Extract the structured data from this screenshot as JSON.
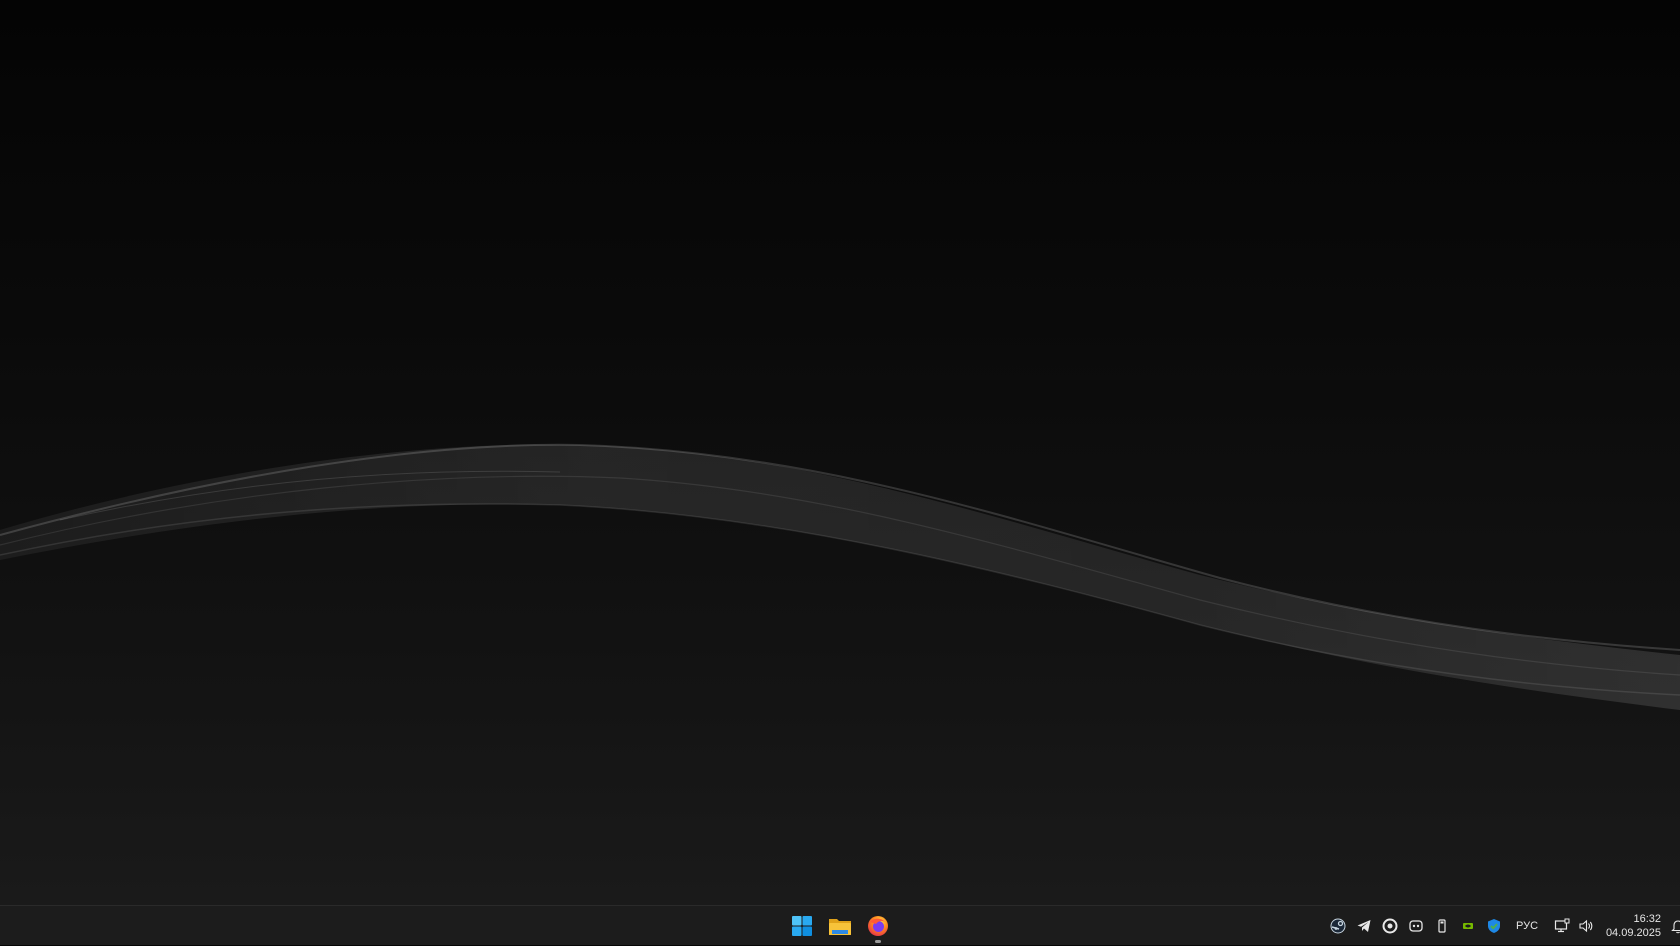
{
  "taskbar": {
    "pinned_apps": [
      {
        "name": "Start",
        "icon": "windows-start-icon",
        "running": false
      },
      {
        "name": "File Explorer",
        "icon": "folder-icon",
        "running": false
      },
      {
        "name": "Firefox",
        "icon": "firefox-icon",
        "running": true
      }
    ],
    "tray_icons": [
      "steam-icon",
      "telegram-icon",
      "circular-app-icon",
      "copilot-icon",
      "usb-drive-icon",
      "nvidia-icon",
      "windows-security-icon"
    ],
    "language": "РУС",
    "clock": {
      "time": "16:32",
      "date": "04.09.2025"
    }
  },
  "colors": {
    "taskbar_bg": "#1c1c1c",
    "desktop_top": "#040404",
    "desktop_bottom": "#1a1a1a",
    "accent_start": "#2aa0f0",
    "nvidia_green": "#76b900"
  }
}
